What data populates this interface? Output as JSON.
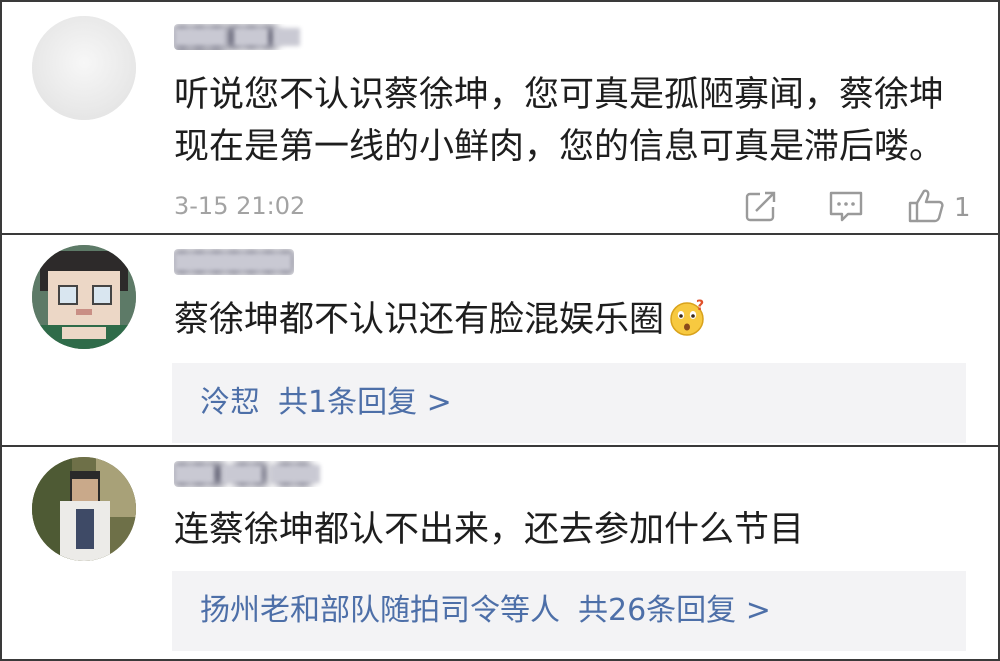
{
  "comments": [
    {
      "username": "██████ ███",
      "text_lines": [
        "听说您不认识蔡徐坤，您可真是孤陋寡闻，蔡徐坤",
        "现在是第一线的小鲜肉，您的信息可真是滞后喽。"
      ],
      "time": "3-15 21:02",
      "like_count": "1",
      "icons": [
        "share-icon",
        "comment-icon",
        "thumbs-up-icon"
      ]
    },
    {
      "username": "███████",
      "text": "蔡徐坤都不认识还有脸混娱乐圈",
      "emoji": "confused-face-emoji",
      "reply": {
        "name": "泠恝",
        "summary": "共1条回复 >"
      }
    },
    {
      "username": "███ ██ ██",
      "text": "连蔡徐坤都认不出来，还去参加什么节目",
      "reply": {
        "name": "扬州老和部队随拍司令等人",
        "summary": "共26条回复 >"
      }
    }
  ],
  "colors": {
    "divider": "#3a3a3a",
    "reply_link": "#4d6fa8",
    "meta_text": "#a3a3a3",
    "reply_bg": "#f3f3f5"
  }
}
